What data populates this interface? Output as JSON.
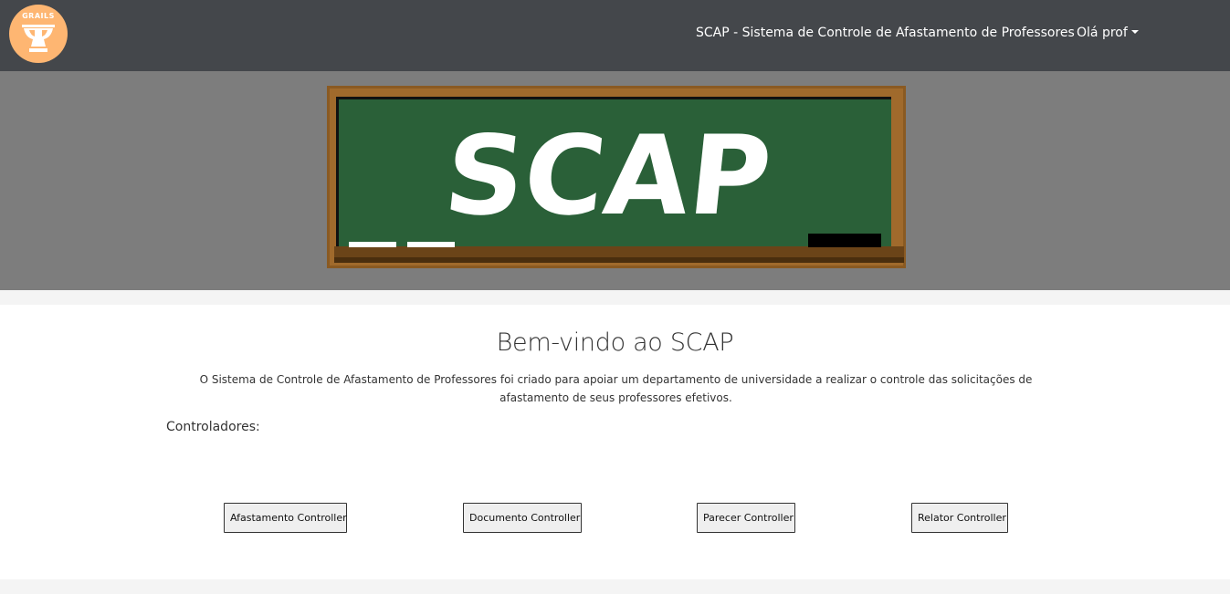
{
  "header": {
    "logo_text": "GRAILS",
    "title": "SCAP - Sistema de Controle de Afastamento de Professores",
    "user_menu": "Olá prof"
  },
  "banner": {
    "board_text": "SCAP"
  },
  "main": {
    "heading": "Bem-vindo ao SCAP",
    "description": "O Sistema de Controle de Afastamento de Professores foi criado para apoiar um departamento de universidade a realizar o controle das solicitações de afastamento de seus professores efetivos.",
    "controllers_label": "Controladores:",
    "controllers": [
      {
        "label": "Afastamento Controller"
      },
      {
        "label": "Documento Controller"
      },
      {
        "label": "Parecer Controller"
      },
      {
        "label": "Relator Controller"
      }
    ]
  },
  "colors": {
    "navbar": "#44474b",
    "logo": "#feb672",
    "banner": "#7d7d7d",
    "chalkboard": "#2a6038",
    "frame": "#8a5a22"
  }
}
